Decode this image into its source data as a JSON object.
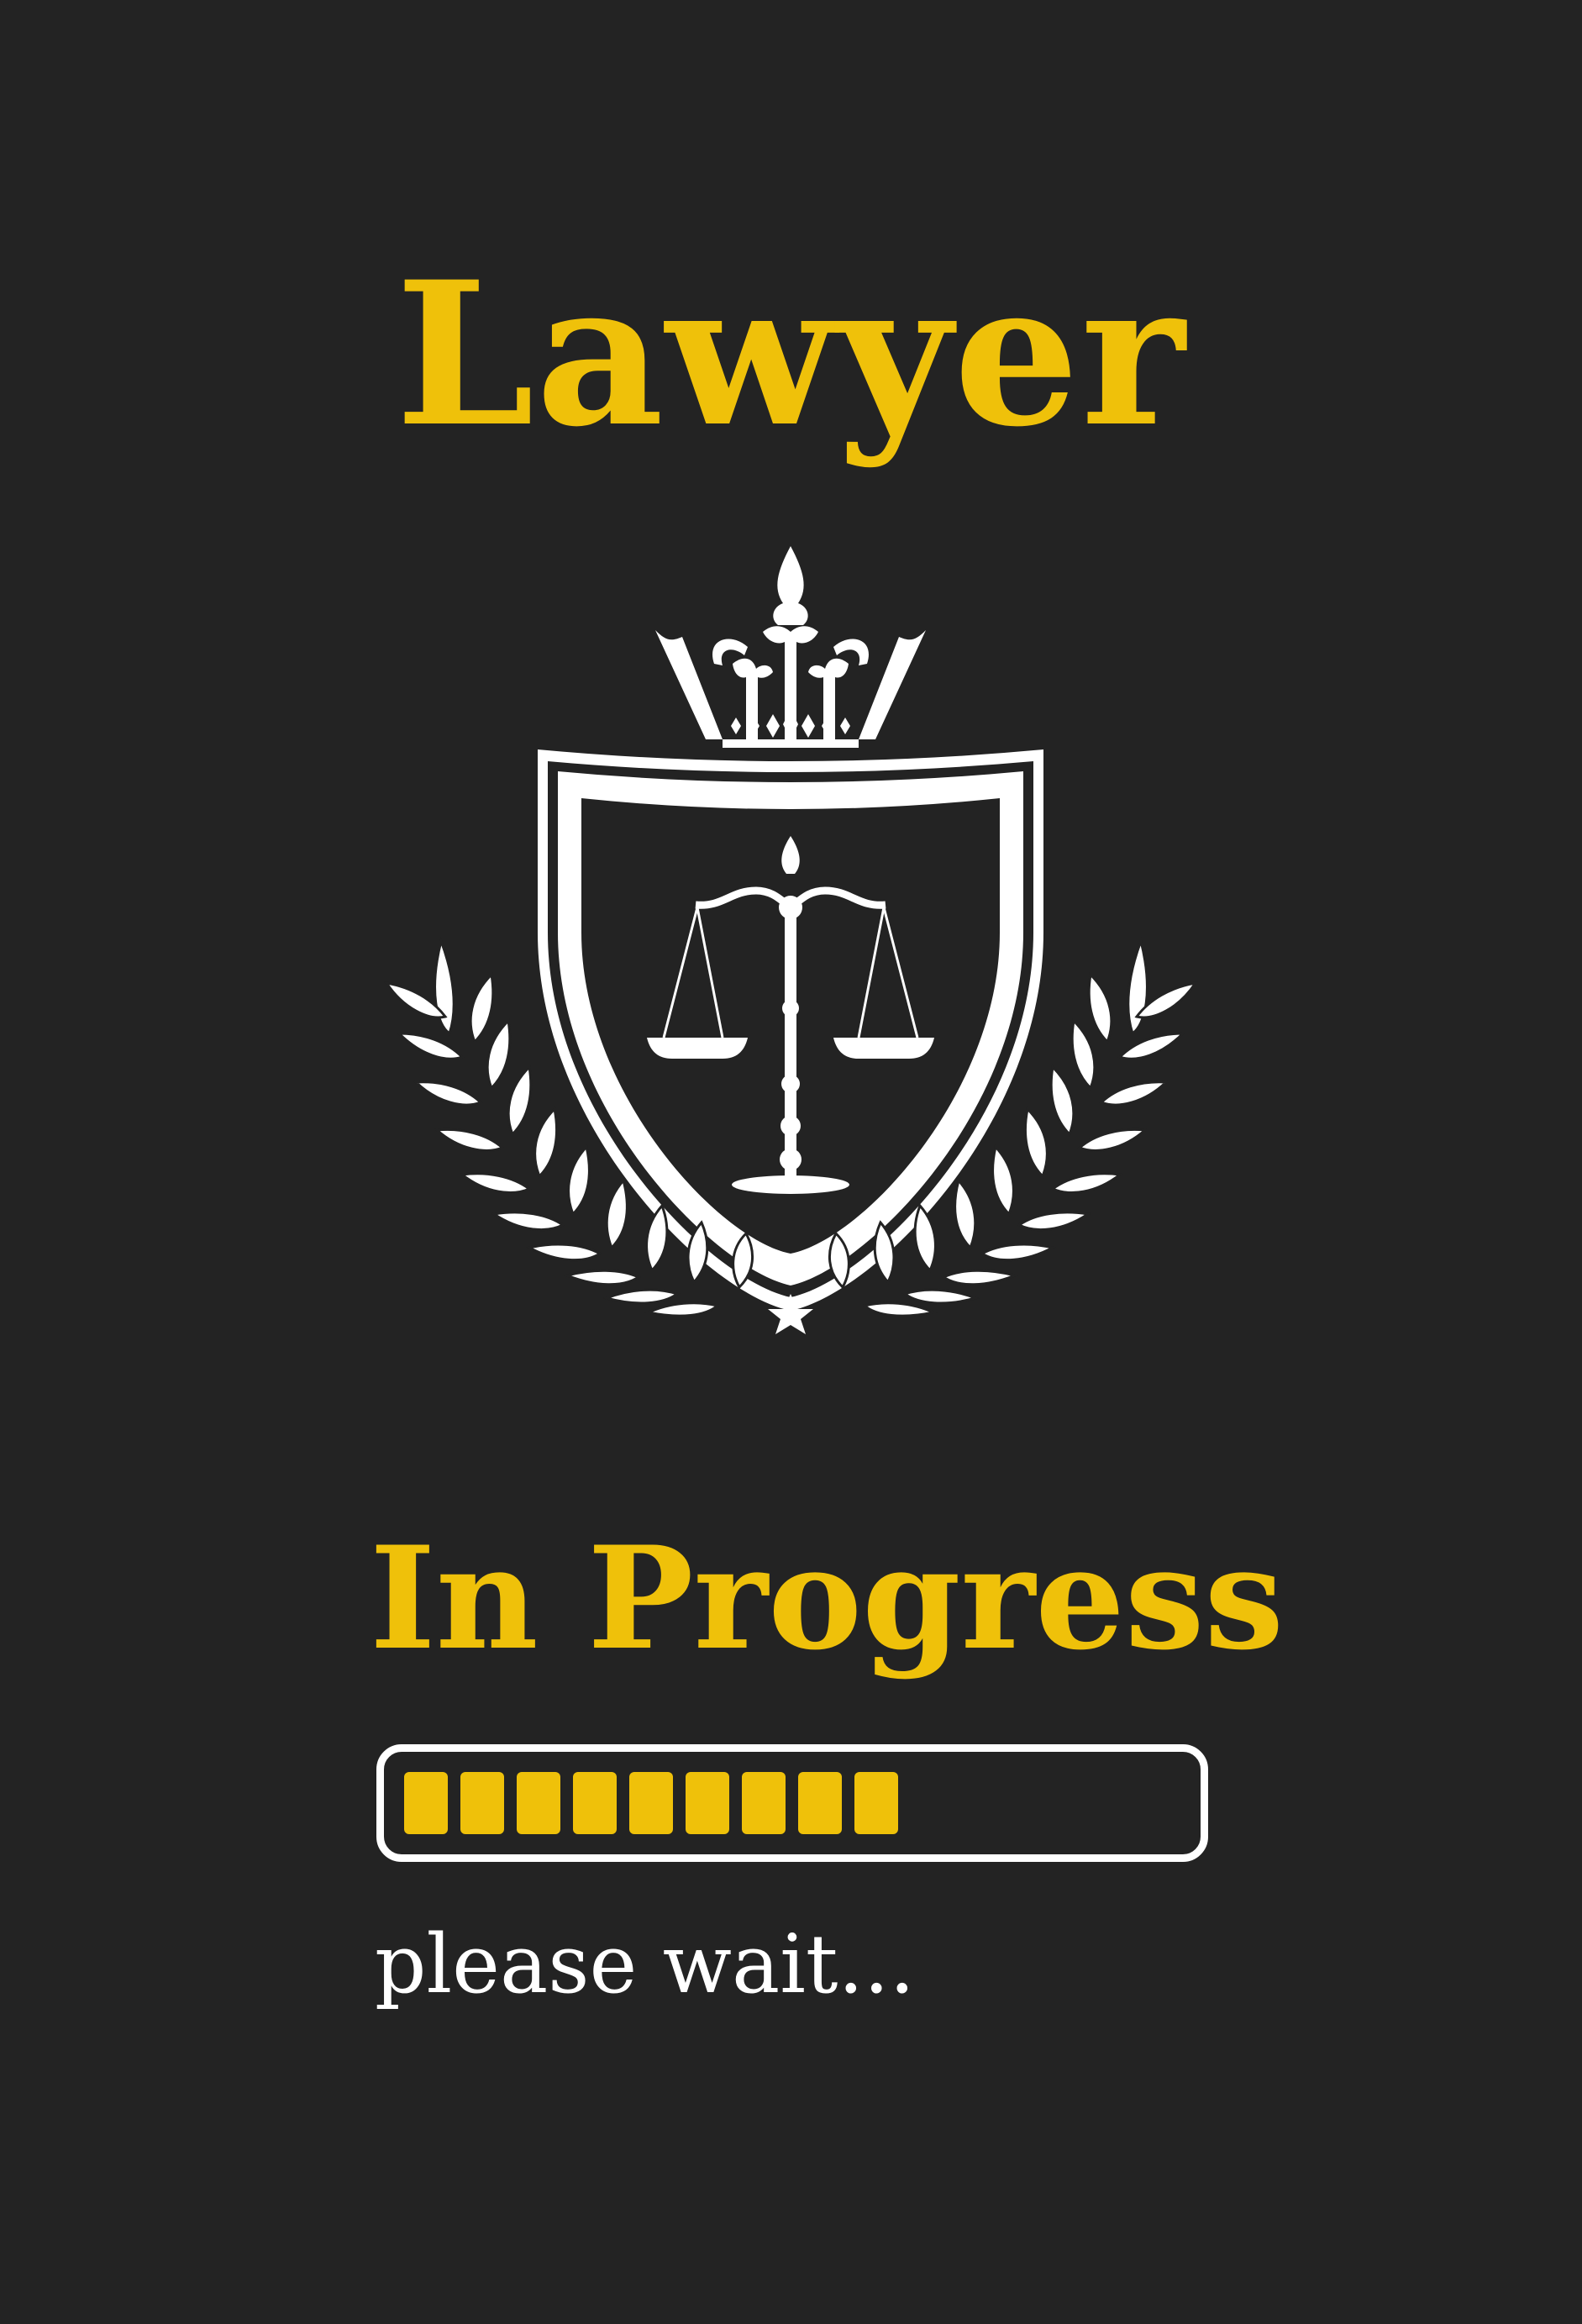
{
  "title": "Lawyer",
  "subtitle": "In Progress",
  "status_text": "please wait...",
  "progress": {
    "filled_segments": 9,
    "total_segments": 14,
    "fraction": 0.64
  },
  "colors": {
    "background": "#232323",
    "accent": "#efc10a",
    "emblem": "#ffffff"
  },
  "emblem": {
    "icons": [
      "crown-icon",
      "shield-icon",
      "scales-of-justice-icon",
      "laurel-wreath-icon",
      "star-icon"
    ]
  }
}
